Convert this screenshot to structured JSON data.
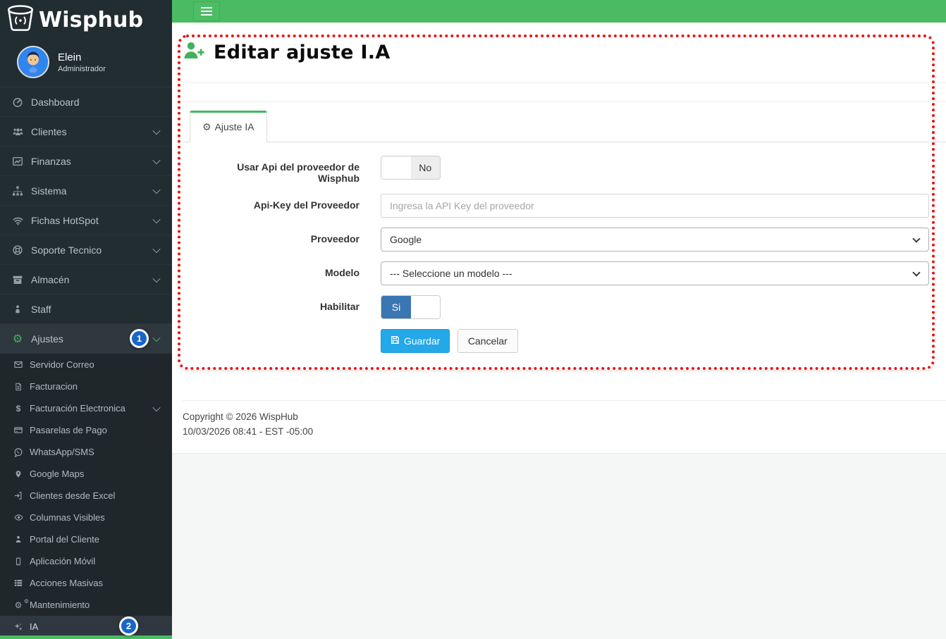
{
  "colors": {
    "topbar_green": "#4abb62",
    "sidebar_dark": "#222d32",
    "tab_accent_green": "#3cb95c",
    "gear_green": "#43b15a",
    "save_button_blue": "#23a8e8",
    "toggle_on_blue": "#3a76b2",
    "annotation_red": "#ee1111",
    "step_badge_blue": "#1766c8"
  },
  "topbar": {
    "hamburger_icon": "hamburger-menu-icon"
  },
  "sidebar": {
    "logo_text": "Wisphub",
    "logo_icon": "wisphub-bucket-antenna-icon",
    "user": {
      "name": "Elein",
      "role": "Administrador",
      "avatar_icon": "user-avatar-cartoon"
    },
    "items": [
      {
        "label": "Dashboard",
        "icon": "tachometer-icon"
      },
      {
        "label": "Clientes",
        "icon": "users-icon",
        "expandable": true
      },
      {
        "label": "Finanzas",
        "icon": "chart-line-icon",
        "expandable": true
      },
      {
        "label": "Sistema",
        "icon": "sitemap-icon",
        "expandable": true
      },
      {
        "label": "Fichas HotSpot",
        "icon": "wifi-icon",
        "expandable": true
      },
      {
        "label": "Soporte Tecnico",
        "icon": "life-ring-icon",
        "expandable": true
      },
      {
        "label": "Almacén",
        "icon": "archive-box-icon",
        "expandable": true
      },
      {
        "label": "Staff",
        "icon": "person-icon"
      },
      {
        "label": "Ajustes",
        "icon": "gear-icon",
        "expandable": true,
        "expanded": true
      }
    ],
    "ajustes_children": [
      {
        "label": "Servidor Correo",
        "icon": "envelope-icon"
      },
      {
        "label": "Facturacion",
        "icon": "file-text-icon"
      },
      {
        "label": "Facturación Electronica",
        "icon": "dollar-icon",
        "expandable": true
      },
      {
        "label": "Pasarelas de Pago",
        "icon": "credit-card-icon"
      },
      {
        "label": "WhatsApp/SMS",
        "icon": "whatsapp-icon"
      },
      {
        "label": "Google Maps",
        "icon": "map-marker-icon"
      },
      {
        "label": "Clientes desde Excel",
        "icon": "sign-in-icon"
      },
      {
        "label": "Columnas Visibles",
        "icon": "eye-icon"
      },
      {
        "label": "Portal del Cliente",
        "icon": "user-icon"
      },
      {
        "label": "Aplicación Móvil",
        "icon": "mobile-icon"
      },
      {
        "label": "Acciones Masivas",
        "icon": "list-rows-icon"
      },
      {
        "label": "Mantenimiento",
        "icon": "cogs-icon"
      },
      {
        "label": "IA",
        "icon": "sparkles-icon",
        "active": true
      }
    ]
  },
  "main": {
    "header": {
      "title": "Editar ajuste I.A",
      "icon": "user-plus-icon"
    },
    "tab": {
      "label": "Ajuste IA",
      "icon": "gear-icon",
      "active": true
    },
    "form": {
      "use_api": {
        "label": "Usar Api del proveedor de Wisphub",
        "value": "No",
        "state": "off"
      },
      "api_key": {
        "label": "Api-Key del Proveedor",
        "value": "",
        "placeholder": "Ingresa la API Key del proveedor"
      },
      "provider": {
        "label": "Proveedor",
        "value": "Google"
      },
      "model": {
        "label": "Modelo",
        "value": "--- Seleccione un modelo ---"
      },
      "enable": {
        "label": "Habilitar",
        "value": "Si",
        "state": "on"
      },
      "save_label": "Guardar",
      "save_icon": "floppy-disk-icon",
      "cancel_label": "Cancelar"
    },
    "footer": {
      "copyright": "Copyright © 2026 WispHub",
      "timestamp": "10/03/2026 08:41 - EST -05:00"
    }
  },
  "annotations": {
    "steps": [
      {
        "number": "1"
      },
      {
        "number": "2"
      }
    ]
  }
}
